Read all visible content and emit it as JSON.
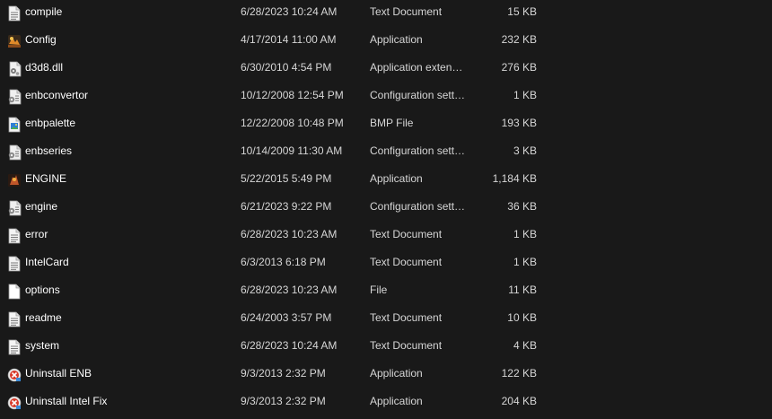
{
  "files": [
    {
      "name": "compile",
      "date": "6/28/2023 10:24 AM",
      "type": "Text Document",
      "size": "15 KB",
      "icon": "text-document-icon"
    },
    {
      "name": "Config",
      "date": "4/17/2014 11:00 AM",
      "type": "Application",
      "size": "232 KB",
      "icon": "application-icon"
    },
    {
      "name": "d3d8.dll",
      "date": "6/30/2010 4:54 PM",
      "type": "Application exten…",
      "size": "276 KB",
      "icon": "dll-icon"
    },
    {
      "name": "enbconvertor",
      "date": "10/12/2008 12:54 PM",
      "type": "Configuration sett…",
      "size": "1 KB",
      "icon": "config-file-icon"
    },
    {
      "name": "enbpalette",
      "date": "12/22/2008 10:48 PM",
      "type": "BMP File",
      "size": "193 KB",
      "icon": "bmp-file-icon"
    },
    {
      "name": "enbseries",
      "date": "10/14/2009 11:30 AM",
      "type": "Configuration sett…",
      "size": "3 KB",
      "icon": "config-file-icon"
    },
    {
      "name": "ENGINE",
      "date": "5/22/2015 5:49 PM",
      "type": "Application",
      "size": "1,184 KB",
      "icon": "engine-app-icon"
    },
    {
      "name": "engine",
      "date": "6/21/2023 9:22 PM",
      "type": "Configuration sett…",
      "size": "36 KB",
      "icon": "config-file-icon"
    },
    {
      "name": "error",
      "date": "6/28/2023 10:23 AM",
      "type": "Text Document",
      "size": "1 KB",
      "icon": "text-document-icon"
    },
    {
      "name": "IntelCard",
      "date": "6/3/2013 6:18 PM",
      "type": "Text Document",
      "size": "1 KB",
      "icon": "text-document-icon"
    },
    {
      "name": "options",
      "date": "6/28/2023 10:23 AM",
      "type": "File",
      "size": "11 KB",
      "icon": "blank-file-icon"
    },
    {
      "name": "readme",
      "date": "6/24/2003 3:57 PM",
      "type": "Text Document",
      "size": "10 KB",
      "icon": "text-document-icon"
    },
    {
      "name": "system",
      "date": "6/28/2023 10:24 AM",
      "type": "Text Document",
      "size": "4 KB",
      "icon": "text-document-icon"
    },
    {
      "name": "Uninstall ENB",
      "date": "9/3/2013 2:32 PM",
      "type": "Application",
      "size": "122 KB",
      "icon": "uninstaller-icon"
    },
    {
      "name": "Uninstall Intel Fix",
      "date": "9/3/2013 2:32 PM",
      "type": "Application",
      "size": "204 KB",
      "icon": "uninstaller-icon"
    }
  ],
  "colors": {
    "background": "#191919",
    "name_text": "#ffffff",
    "detail_text": "#d6d6d6"
  }
}
